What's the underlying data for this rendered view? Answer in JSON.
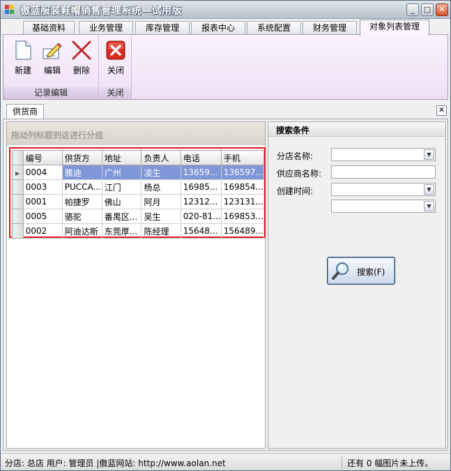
{
  "window": {
    "title": "傲蓝服装鞋帽销售管理系统—试用版",
    "controls": {
      "minimize": "_",
      "maximize": "□",
      "close": "✕"
    }
  },
  "tabs": [
    {
      "label": "基础资料",
      "active": false
    },
    {
      "label": "业务管理",
      "active": false
    },
    {
      "label": "库存管理",
      "active": false
    },
    {
      "label": "报表中心",
      "active": false
    },
    {
      "label": "系统配置",
      "active": false
    },
    {
      "label": "财务管理",
      "active": false
    },
    {
      "label": "对象列表管理",
      "active": true
    }
  ],
  "ribbon": {
    "groups": [
      {
        "label": "记录编辑",
        "buttons": [
          {
            "label": "新建",
            "icon": "new-document-icon"
          },
          {
            "label": "编辑",
            "icon": "edit-pencil-icon"
          },
          {
            "label": "删除",
            "icon": "delete-x-icon"
          }
        ]
      },
      {
        "label": "关闭",
        "buttons": [
          {
            "label": "关闭",
            "icon": "close-red-icon"
          }
        ]
      }
    ]
  },
  "document_tab": {
    "label": "供货商",
    "close": "✕"
  },
  "grid": {
    "group_hint": "拖动列标题到这进行分组",
    "columns": [
      "编号",
      "供货方",
      "地址",
      "负责人",
      "电话",
      "手机"
    ],
    "rows": [
      [
        "0004",
        "雅迪",
        "广州",
        "凌生",
        "13659...",
        "136597..."
      ],
      [
        "0003",
        "PUCCA...",
        "江门",
        "杨总",
        "16985...",
        "169854..."
      ],
      [
        "0001",
        "帕捷罗",
        "佛山",
        "阿月",
        "12312...",
        "123131..."
      ],
      [
        "0005",
        "骆驼",
        "番禺区...",
        "吴生",
        "020-81...",
        "169853..."
      ],
      [
        "0002",
        "阿迪达斯",
        "东莞厚...",
        "陈经理",
        "15648...",
        "156489..."
      ]
    ],
    "selected_row": 0,
    "selection_color": "#7f96d8"
  },
  "search": {
    "title": "搜索条件",
    "fields": [
      {
        "label": "分店名称:",
        "type": "combo",
        "value": ""
      },
      {
        "label": "供应商名称:",
        "type": "text",
        "value": ""
      },
      {
        "label": "创建时间:",
        "type": "combo",
        "value": ""
      },
      {
        "label": "",
        "type": "combo",
        "value": ""
      }
    ],
    "button_label": "搜索(F)"
  },
  "statusbar": {
    "left": "分店: 总店  用户: 管理员  |傲蓝网站: http://www.aolan.net",
    "right": "还有 0 幅图片未上传。"
  },
  "colors": {
    "highlight_border": "#e0141e",
    "accent": "#7f96d8"
  }
}
